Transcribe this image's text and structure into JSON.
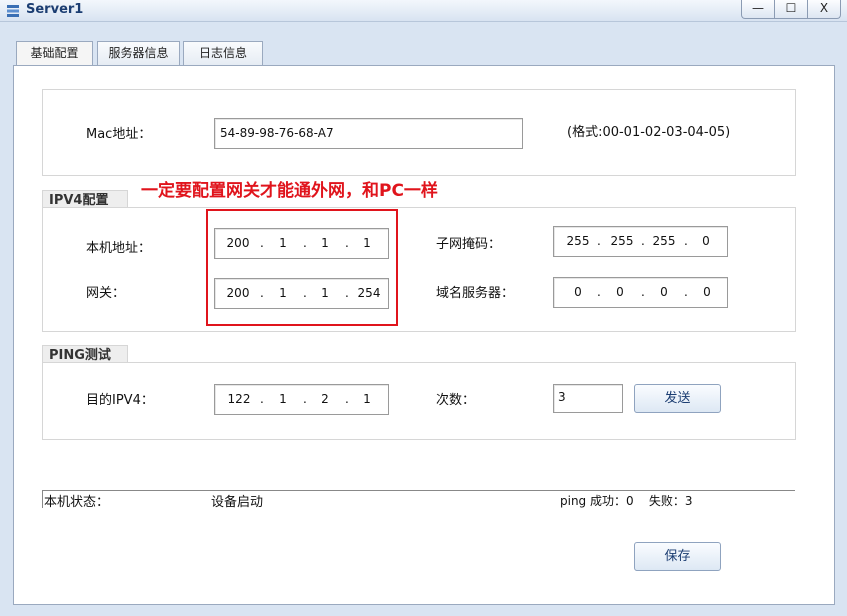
{
  "window": {
    "title": "Server1",
    "minimize_label": "—",
    "maximize_label": "☐",
    "close_label": "X"
  },
  "tabs": [
    {
      "label": "基础配置",
      "active": true
    },
    {
      "label": "服务器信息",
      "active": false
    },
    {
      "label": "日志信息",
      "active": false
    }
  ],
  "mac": {
    "label": "Mac地址：",
    "value": "54-89-98-76-68-A7",
    "format_hint": "(格式:00-01-02-03-04-05)"
  },
  "annotation": {
    "text": "一定要配置网关才能通外网，和PC一样",
    "color": "#e0141c"
  },
  "ipv4": {
    "section_title": "IPV4配置",
    "local_ip_label": "本机地址：",
    "local_ip": [
      "200",
      "1",
      "1",
      "1"
    ],
    "gateway_label": "网关：",
    "gateway": [
      "200",
      "1",
      "1",
      "254"
    ],
    "subnet_label": "子网掩码：",
    "subnet": [
      "255",
      "255",
      "255",
      "0"
    ],
    "dns_label": "域名服务器：",
    "dns": [
      "0",
      "0",
      "0",
      "0"
    ]
  },
  "ping": {
    "section_title": "PING测试",
    "target_label": "目的IPV4：",
    "target": [
      "122",
      "1",
      "2",
      "1"
    ],
    "count_label": "次数：",
    "count": "3",
    "send_label": "发送"
  },
  "status": {
    "label": "本机状态：",
    "value": "设备启动",
    "ping_result": "ping 成功：0    失败：3"
  },
  "save_label": "保存"
}
